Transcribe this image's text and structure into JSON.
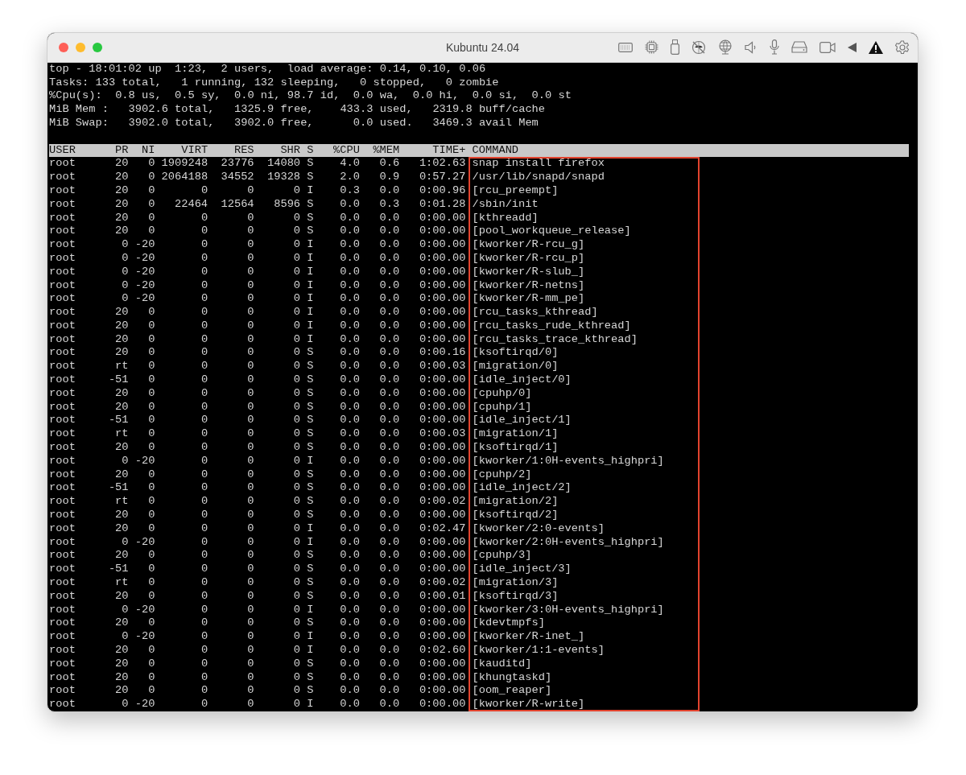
{
  "window": {
    "title": "Kubuntu 24.04"
  },
  "terminal": {
    "summary_lines": [
      "top - 18:01:02 up  1:23,  2 users,  load average: 0.14, 0.10, 0.06",
      "Tasks: 133 total,   1 running, 132 sleeping,   0 stopped,   0 zombie",
      "%Cpu(s):  0.8 us,  0.5 sy,  0.0 ni, 98.7 id,  0.0 wa,  0.0 hi,  0.0 si,  0.0 st",
      "MiB Mem :   3902.6 total,   1325.9 free,    433.3 used,   2319.8 buff/cache",
      "MiB Swap:   3902.0 total,   3902.0 free,      0.0 used.   3469.3 avail Mem"
    ],
    "table": {
      "columns": [
        "USER",
        "PR",
        "NI",
        "VIRT",
        "RES",
        "SHR",
        "S",
        "%CPU",
        "%MEM",
        "TIME+",
        "COMMAND"
      ],
      "rows": [
        [
          "root",
          "20",
          "0",
          "1909248",
          "23776",
          "14080",
          "S",
          "4.0",
          "0.6",
          "1:02.63",
          "snap install firefox"
        ],
        [
          "root",
          "20",
          "0",
          "2064188",
          "34552",
          "19328",
          "S",
          "2.0",
          "0.9",
          "0:57.27",
          "/usr/lib/snapd/snapd"
        ],
        [
          "root",
          "20",
          "0",
          "0",
          "0",
          "0",
          "I",
          "0.3",
          "0.0",
          "0:00.96",
          "[rcu_preempt]"
        ],
        [
          "root",
          "20",
          "0",
          "22464",
          "12564",
          "8596",
          "S",
          "0.0",
          "0.3",
          "0:01.28",
          "/sbin/init"
        ],
        [
          "root",
          "20",
          "0",
          "0",
          "0",
          "0",
          "S",
          "0.0",
          "0.0",
          "0:00.00",
          "[kthreadd]"
        ],
        [
          "root",
          "20",
          "0",
          "0",
          "0",
          "0",
          "S",
          "0.0",
          "0.0",
          "0:00.00",
          "[pool_workqueue_release]"
        ],
        [
          "root",
          "0",
          "-20",
          "0",
          "0",
          "0",
          "I",
          "0.0",
          "0.0",
          "0:00.00",
          "[kworker/R-rcu_g]"
        ],
        [
          "root",
          "0",
          "-20",
          "0",
          "0",
          "0",
          "I",
          "0.0",
          "0.0",
          "0:00.00",
          "[kworker/R-rcu_p]"
        ],
        [
          "root",
          "0",
          "-20",
          "0",
          "0",
          "0",
          "I",
          "0.0",
          "0.0",
          "0:00.00",
          "[kworker/R-slub_]"
        ],
        [
          "root",
          "0",
          "-20",
          "0",
          "0",
          "0",
          "I",
          "0.0",
          "0.0",
          "0:00.00",
          "[kworker/R-netns]"
        ],
        [
          "root",
          "0",
          "-20",
          "0",
          "0",
          "0",
          "I",
          "0.0",
          "0.0",
          "0:00.00",
          "[kworker/R-mm_pe]"
        ],
        [
          "root",
          "20",
          "0",
          "0",
          "0",
          "0",
          "I",
          "0.0",
          "0.0",
          "0:00.00",
          "[rcu_tasks_kthread]"
        ],
        [
          "root",
          "20",
          "0",
          "0",
          "0",
          "0",
          "I",
          "0.0",
          "0.0",
          "0:00.00",
          "[rcu_tasks_rude_kthread]"
        ],
        [
          "root",
          "20",
          "0",
          "0",
          "0",
          "0",
          "I",
          "0.0",
          "0.0",
          "0:00.00",
          "[rcu_tasks_trace_kthread]"
        ],
        [
          "root",
          "20",
          "0",
          "0",
          "0",
          "0",
          "S",
          "0.0",
          "0.0",
          "0:00.16",
          "[ksoftirqd/0]"
        ],
        [
          "root",
          "rt",
          "0",
          "0",
          "0",
          "0",
          "S",
          "0.0",
          "0.0",
          "0:00.03",
          "[migration/0]"
        ],
        [
          "root",
          "-51",
          "0",
          "0",
          "0",
          "0",
          "S",
          "0.0",
          "0.0",
          "0:00.00",
          "[idle_inject/0]"
        ],
        [
          "root",
          "20",
          "0",
          "0",
          "0",
          "0",
          "S",
          "0.0",
          "0.0",
          "0:00.00",
          "[cpuhp/0]"
        ],
        [
          "root",
          "20",
          "0",
          "0",
          "0",
          "0",
          "S",
          "0.0",
          "0.0",
          "0:00.00",
          "[cpuhp/1]"
        ],
        [
          "root",
          "-51",
          "0",
          "0",
          "0",
          "0",
          "S",
          "0.0",
          "0.0",
          "0:00.00",
          "[idle_inject/1]"
        ],
        [
          "root",
          "rt",
          "0",
          "0",
          "0",
          "0",
          "S",
          "0.0",
          "0.0",
          "0:00.03",
          "[migration/1]"
        ],
        [
          "root",
          "20",
          "0",
          "0",
          "0",
          "0",
          "S",
          "0.0",
          "0.0",
          "0:00.00",
          "[ksoftirqd/1]"
        ],
        [
          "root",
          "0",
          "-20",
          "0",
          "0",
          "0",
          "I",
          "0.0",
          "0.0",
          "0:00.00",
          "[kworker/1:0H-events_highpri]"
        ],
        [
          "root",
          "20",
          "0",
          "0",
          "0",
          "0",
          "S",
          "0.0",
          "0.0",
          "0:00.00",
          "[cpuhp/2]"
        ],
        [
          "root",
          "-51",
          "0",
          "0",
          "0",
          "0",
          "S",
          "0.0",
          "0.0",
          "0:00.00",
          "[idle_inject/2]"
        ],
        [
          "root",
          "rt",
          "0",
          "0",
          "0",
          "0",
          "S",
          "0.0",
          "0.0",
          "0:00.02",
          "[migration/2]"
        ],
        [
          "root",
          "20",
          "0",
          "0",
          "0",
          "0",
          "S",
          "0.0",
          "0.0",
          "0:00.00",
          "[ksoftirqd/2]"
        ],
        [
          "root",
          "20",
          "0",
          "0",
          "0",
          "0",
          "I",
          "0.0",
          "0.0",
          "0:02.47",
          "[kworker/2:0-events]"
        ],
        [
          "root",
          "0",
          "-20",
          "0",
          "0",
          "0",
          "I",
          "0.0",
          "0.0",
          "0:00.00",
          "[kworker/2:0H-events_highpri]"
        ],
        [
          "root",
          "20",
          "0",
          "0",
          "0",
          "0",
          "S",
          "0.0",
          "0.0",
          "0:00.00",
          "[cpuhp/3]"
        ],
        [
          "root",
          "-51",
          "0",
          "0",
          "0",
          "0",
          "S",
          "0.0",
          "0.0",
          "0:00.00",
          "[idle_inject/3]"
        ],
        [
          "root",
          "rt",
          "0",
          "0",
          "0",
          "0",
          "S",
          "0.0",
          "0.0",
          "0:00.02",
          "[migration/3]"
        ],
        [
          "root",
          "20",
          "0",
          "0",
          "0",
          "0",
          "S",
          "0.0",
          "0.0",
          "0:00.01",
          "[ksoftirqd/3]"
        ],
        [
          "root",
          "0",
          "-20",
          "0",
          "0",
          "0",
          "I",
          "0.0",
          "0.0",
          "0:00.00",
          "[kworker/3:0H-events_highpri]"
        ],
        [
          "root",
          "20",
          "0",
          "0",
          "0",
          "0",
          "S",
          "0.0",
          "0.0",
          "0:00.00",
          "[kdevtmpfs]"
        ],
        [
          "root",
          "0",
          "-20",
          "0",
          "0",
          "0",
          "I",
          "0.0",
          "0.0",
          "0:00.00",
          "[kworker/R-inet_]"
        ],
        [
          "root",
          "20",
          "0",
          "0",
          "0",
          "0",
          "I",
          "0.0",
          "0.0",
          "0:02.60",
          "[kworker/1:1-events]"
        ],
        [
          "root",
          "20",
          "0",
          "0",
          "0",
          "0",
          "S",
          "0.0",
          "0.0",
          "0:00.00",
          "[kauditd]"
        ],
        [
          "root",
          "20",
          "0",
          "0",
          "0",
          "0",
          "S",
          "0.0",
          "0.0",
          "0:00.00",
          "[khungtaskd]"
        ],
        [
          "root",
          "20",
          "0",
          "0",
          "0",
          "0",
          "S",
          "0.0",
          "0.0",
          "0:00.00",
          "[oom_reaper]"
        ],
        [
          "root",
          "0",
          "-20",
          "0",
          "0",
          "0",
          "I",
          "0.0",
          "0.0",
          "0:00.00",
          "[kworker/R-write]"
        ]
      ]
    }
  }
}
